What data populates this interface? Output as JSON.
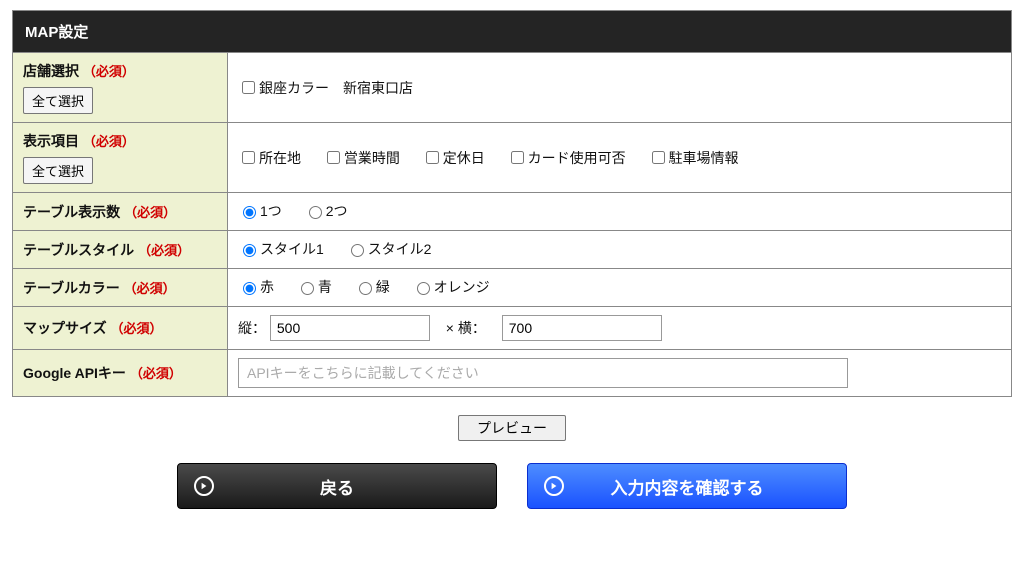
{
  "header": {
    "title": "MAP設定"
  },
  "required_label": "（必須）",
  "rows": {
    "store": {
      "label": "店舗選択",
      "select_all": "全て選択",
      "options": [
        "銀座カラー　新宿東口店"
      ]
    },
    "fields": {
      "label": "表示項目",
      "select_all": "全て選択",
      "options": [
        "所在地",
        "営業時間",
        "定休日",
        "カード使用可否",
        "駐車場情報"
      ]
    },
    "table_count": {
      "label": "テーブル表示数",
      "options": [
        "1つ",
        "2つ"
      ],
      "selected": 0
    },
    "table_style": {
      "label": "テーブルスタイル",
      "options": [
        "スタイル1",
        "スタイル2"
      ],
      "selected": 0
    },
    "table_color": {
      "label": "テーブルカラー",
      "options": [
        "赤",
        "青",
        "緑",
        "オレンジ"
      ],
      "selected": 0
    },
    "map_size": {
      "label": "マップサイズ",
      "height_label": "縦：",
      "height_value": "500",
      "sep": "× 横：",
      "width_value": "700"
    },
    "api_key": {
      "label": "Google APIキー",
      "placeholder": "APIキーをこちらに記載してください"
    }
  },
  "preview_label": "プレビュー",
  "buttons": {
    "back": "戻る",
    "confirm": "入力内容を確認する"
  }
}
